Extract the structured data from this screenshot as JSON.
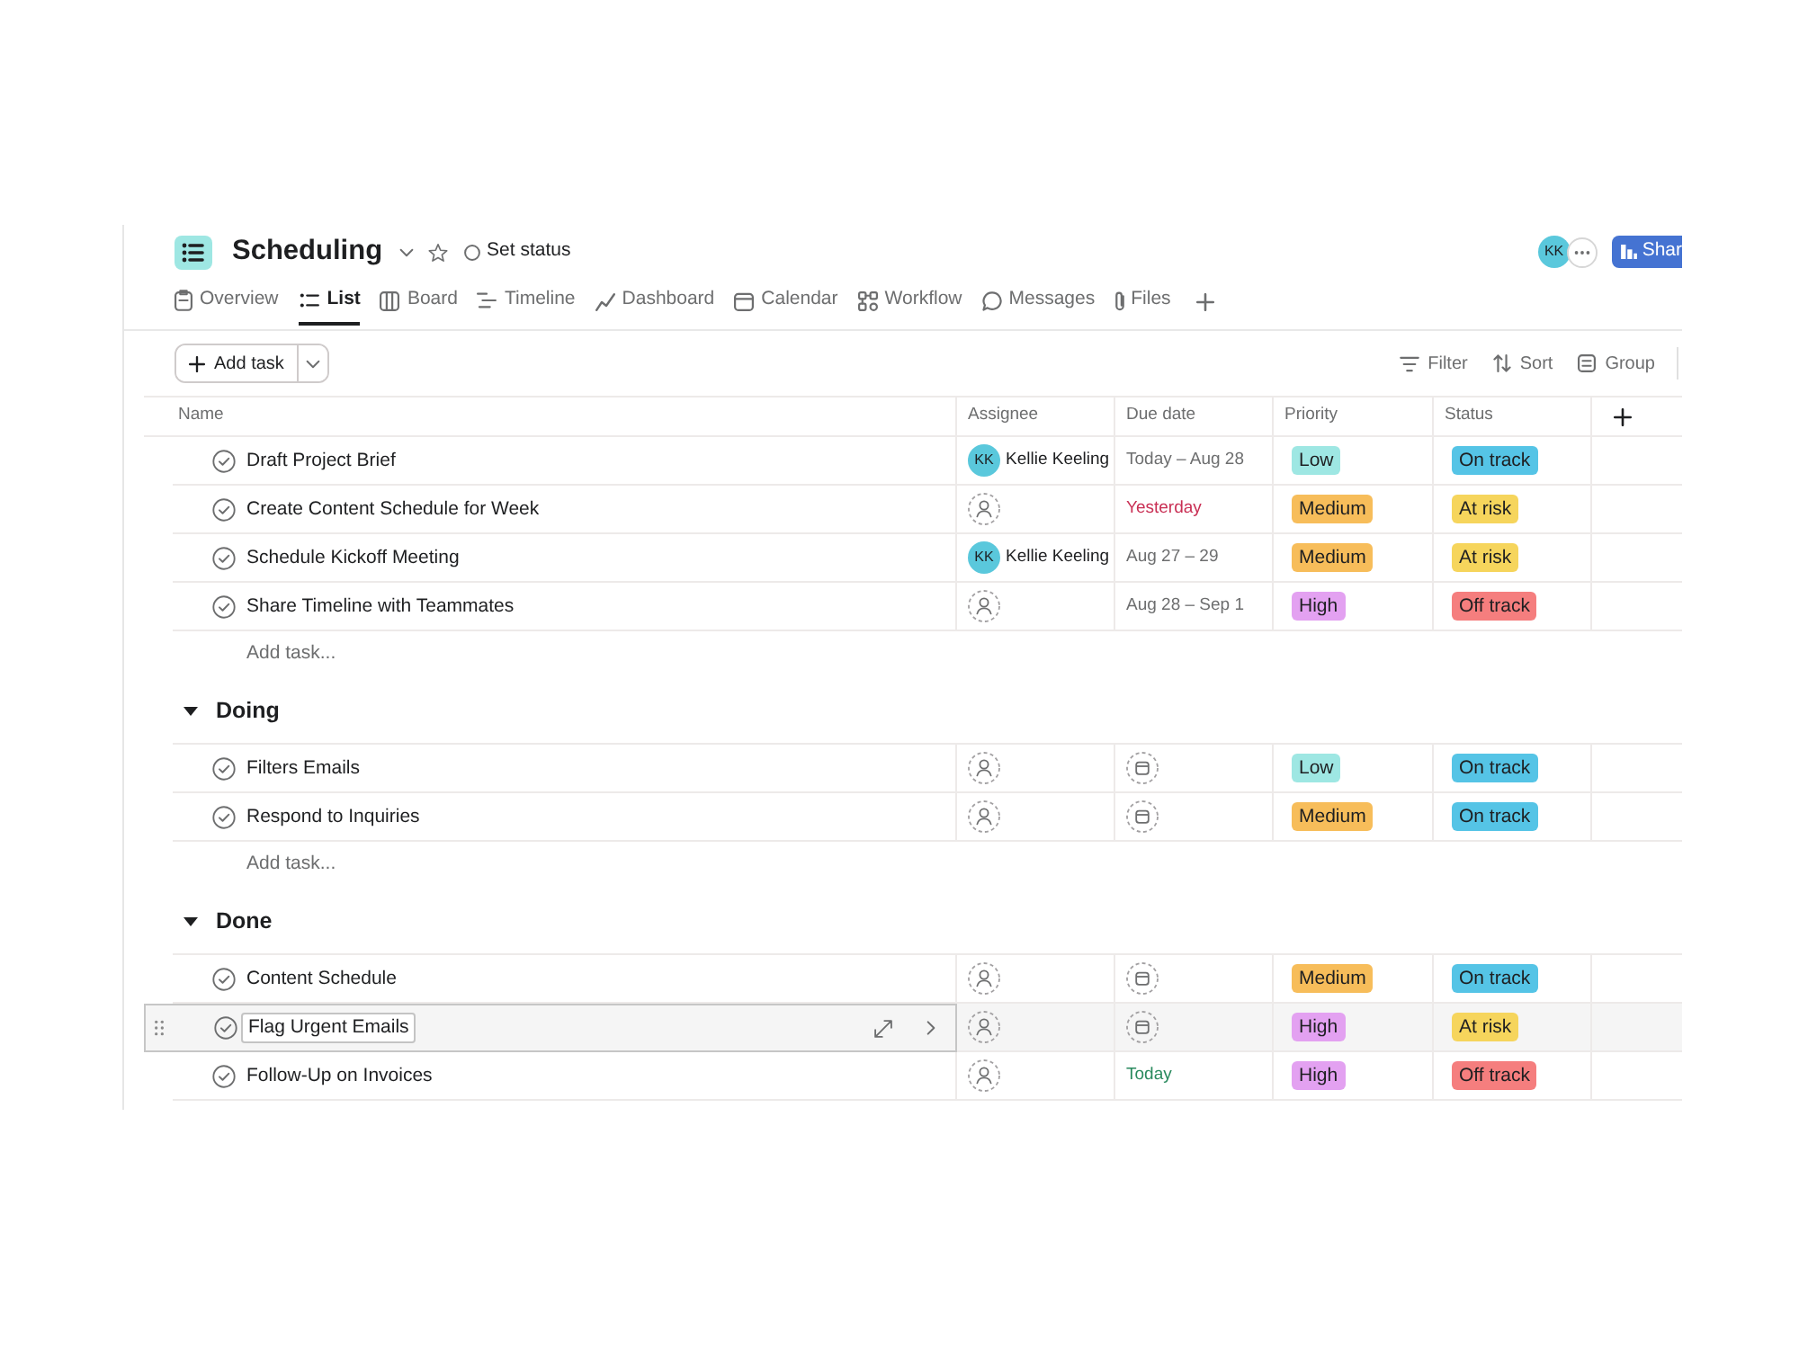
{
  "project": {
    "title": "Scheduling",
    "status_label": "Set status"
  },
  "header_actions": {
    "avatar": "KK",
    "share_label": "Shar"
  },
  "tabs": [
    {
      "label": "Overview",
      "selected": false
    },
    {
      "label": "List",
      "selected": true
    },
    {
      "label": "Board",
      "selected": false
    },
    {
      "label": "Timeline",
      "selected": false
    },
    {
      "label": "Dashboard",
      "selected": false
    },
    {
      "label": "Calendar",
      "selected": false
    },
    {
      "label": "Workflow",
      "selected": false
    },
    {
      "label": "Messages",
      "selected": false
    },
    {
      "label": "Files",
      "selected": false
    }
  ],
  "toolbar": {
    "add_task": "Add task",
    "actions": [
      "Filter",
      "Sort",
      "Group"
    ]
  },
  "table": {
    "columns": [
      "Name",
      "Assignee",
      "Due date",
      "Priority",
      "Status"
    ],
    "rows": [
      {
        "name": "Draft Project Brief",
        "completed": false,
        "selected": false,
        "assignee": {
          "initials": "KK",
          "name": "Kellie Keeling"
        },
        "due": {
          "text": "Today – Aug 28",
          "color": "#6d6e6f"
        },
        "priority": {
          "label": "Low",
          "color": "#9ee7e3"
        },
        "status": {
          "label": "On track",
          "color": "#55c4e6"
        }
      },
      {
        "name": "Create Content Schedule for Week",
        "completed": false,
        "selected": false,
        "due": {
          "text": "Yesterday",
          "color": "#c92f54"
        },
        "priority": {
          "label": "Medium",
          "color": "#f7bd5a"
        },
        "status": {
          "label": "At risk",
          "color": "#f6d55c"
        }
      },
      {
        "name": "Schedule Kickoff Meeting",
        "completed": false,
        "selected": false,
        "assignee": {
          "initials": "KK",
          "name": "Kellie Keeling"
        },
        "due": {
          "text": "Aug 27 – 29",
          "color": "#6d6e6f"
        },
        "priority": {
          "label": "Medium",
          "color": "#f7bd5a"
        },
        "status": {
          "label": "At risk",
          "color": "#f6d55c"
        }
      },
      {
        "name": "Share Timeline with Teammates",
        "completed": false,
        "selected": false,
        "due": {
          "text": "Aug 28 – Sep 1",
          "color": "#6d6e6f"
        },
        "priority": {
          "label": "High",
          "color": "#e3a1f1"
        },
        "status": {
          "label": "Off track",
          "color": "#f57e7e"
        }
      }
    ],
    "add_task": "Add task...",
    "sections": [
      {
        "title": "Doing",
        "expanded": true,
        "rows": [
          {
            "name": "Filters Emails",
            "completed": false,
            "selected": false,
            "priority": {
              "label": "Low",
              "color": "#9ee7e3"
            },
            "status": {
              "label": "On track",
              "color": "#55c4e6"
            }
          },
          {
            "name": "Respond to Inquiries",
            "completed": false,
            "selected": false,
            "priority": {
              "label": "Medium",
              "color": "#f7bd5a"
            },
            "status": {
              "label": "On track",
              "color": "#55c4e6"
            }
          }
        ],
        "add_task": "Add task..."
      },
      {
        "title": "Done",
        "expanded": true,
        "rows": [
          {
            "name": "Content Schedule",
            "completed": false,
            "selected": false,
            "priority": {
              "label": "Medium",
              "color": "#f7bd5a"
            },
            "status": {
              "label": "On track",
              "color": "#55c4e6"
            }
          },
          {
            "name": "Flag Urgent Emails",
            "completed": false,
            "selected": true,
            "priority": {
              "label": "High",
              "color": "#e3a1f1"
            },
            "status": {
              "label": "At risk",
              "color": "#f6d55c"
            }
          },
          {
            "name": "Follow-Up on Invoices",
            "completed": false,
            "selected": false,
            "due": {
              "text": "Today",
              "color": "#2a8a5e"
            },
            "priority": {
              "label": "High",
              "color": "#e3a1f1"
            },
            "status": {
              "label": "Off track",
              "color": "#f57e7e"
            }
          }
        ]
      }
    ]
  }
}
